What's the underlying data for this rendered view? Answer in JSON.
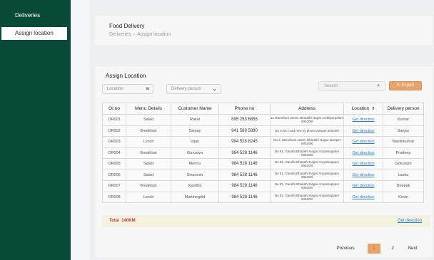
{
  "sidebar": {
    "items": [
      {
        "label": "Deliveries"
      },
      {
        "label": "Assign location"
      }
    ]
  },
  "header": {
    "title": "Food Delivery",
    "breadcrumb": [
      "Deliveries",
      "Assign location"
    ]
  },
  "main": {
    "title": "Assign Location",
    "location_select": {
      "label": "Location",
      "icon": "filter-lines-icon"
    },
    "delivery_select": {
      "label": "Delivery person",
      "icon": "chevron-down-icon"
    },
    "search": {
      "placeholder": "Search",
      "icon": "search-icon"
    },
    "export": {
      "label": "Export",
      "icon": "export-icon",
      "color": "#e9a26a"
    },
    "table": {
      "headers": [
        "Or.no",
        "Menu Details",
        "Customer Name",
        "Phone no",
        "Address",
        "Location",
        "Delivery person"
      ],
      "rows": [
        [
          "OR001",
          "Salad",
          "Rakul",
          "895 253 6855",
          "11 Maruthani street, Bharathi Nagar norkilpurpalam 605200l",
          "Get direction",
          "Kumar"
        ],
        [
          "OR002",
          "Breakfast",
          "Sanjay",
          "941 589 5890",
          "No 5,NG road new by photo lawspet 605200l",
          "Get direction",
          "Sanjay"
        ],
        [
          "OR003",
          "Lunch",
          "Vijay",
          "994 528 8245",
          "No 2, Maruthani street, Bharathi Nagar lawspet 605200l",
          "Get direction",
          "Navilnkumar"
        ],
        [
          "OR004",
          "Breakfast",
          "Gurusiva",
          "984 528 1146",
          "No 81, Gandhi Bharathi Nagar Ariyankuppam 605200l",
          "Get direction",
          "Pradeep"
        ],
        [
          "OR005",
          "Salad",
          "Mennu",
          "984 528 1146",
          "No 81, Gandhi Bharathi Nagar Ariyankuppam 605200l",
          "Get direction",
          "Gokulash"
        ],
        [
          "OR006",
          "Salad",
          "Sivanesh",
          "984 528 1146",
          "No 81, Gandhi Bharathi Nagar Ariyankuppam 605200l",
          "Get direction",
          "Lashu"
        ],
        [
          "OR007",
          "Breakfast",
          "Kavitha",
          "984 528 1146",
          "No 81, Gandhi Bharathi Nagar Ariyankuppam 605200l",
          "Get direction",
          "Deepak"
        ],
        [
          "OR008",
          "Lunch",
          "Martinegold",
          "984 528 1146",
          "No 81, Gandhi Bharathi Nagar Ariyankuppam 605200l",
          "Get direction",
          "Kevin"
        ]
      ]
    },
    "total": {
      "label": "Total",
      "value": "140KM",
      "link": "Get direction"
    },
    "pagination": {
      "previous": "Previous",
      "pages": [
        "1",
        "2"
      ],
      "current": "1",
      "next": "Next"
    }
  },
  "colors": {
    "sidebar_bg": "#0a4a38",
    "accent": "#e9a26a",
    "link": "#2a7fd4",
    "total_text": "#c0392b"
  }
}
